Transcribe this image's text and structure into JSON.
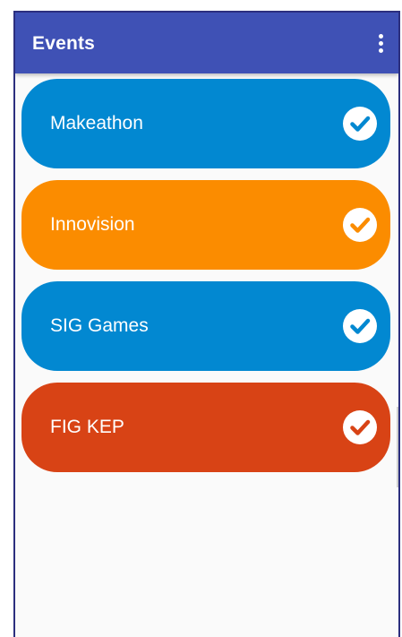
{
  "appbar": {
    "title": "Events",
    "menu_icon": "more-vert-icon",
    "color": "#3f51b5"
  },
  "events": [
    {
      "label": "Makeathon",
      "color": "#0288d1",
      "icon": "check-circle-icon",
      "checked": true
    },
    {
      "label": "Innovision",
      "color": "#fb8c00",
      "icon": "check-circle-icon",
      "checked": true
    },
    {
      "label": "SIG Games",
      "color": "#0288d1",
      "icon": "check-circle-icon",
      "checked": true
    },
    {
      "label": "FIG KEP",
      "color": "#d84315",
      "icon": "check-circle-icon",
      "checked": true
    }
  ]
}
